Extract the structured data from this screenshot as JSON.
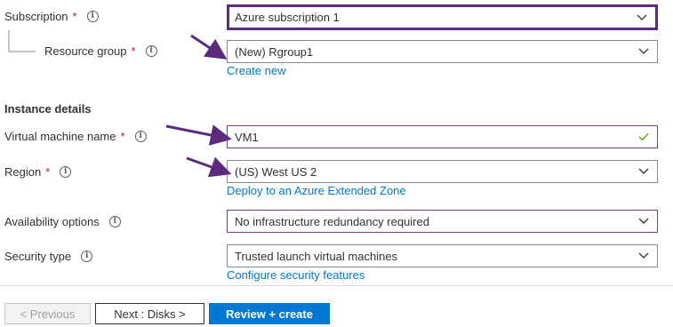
{
  "subscription": {
    "label": "Subscription",
    "required_mark": "*",
    "value": "Azure subscription 1"
  },
  "resource_group": {
    "label": "Resource group",
    "required_mark": "*",
    "value": "(New) Rgroup1",
    "create_link": "Create new"
  },
  "instance_details": {
    "heading": "Instance details"
  },
  "vm_name": {
    "label": "Virtual machine name",
    "required_mark": "*",
    "value": "VM1"
  },
  "region": {
    "label": "Region",
    "required_mark": "*",
    "value": "(US) West US 2",
    "link": "Deploy to an Azure Extended Zone"
  },
  "availability": {
    "label": "Availability options",
    "value": "No infrastructure redundancy required"
  },
  "security": {
    "label": "Security type",
    "value": "Trusted launch virtual machines",
    "link": "Configure security features"
  },
  "footer": {
    "previous": "< Previous",
    "next": "Next : Disks >",
    "review": "Review + create"
  },
  "info_glyph": "i",
  "colors": {
    "accent": "#0078d4",
    "annotation_arrow": "#5c2b80",
    "required": "#a4262c"
  }
}
